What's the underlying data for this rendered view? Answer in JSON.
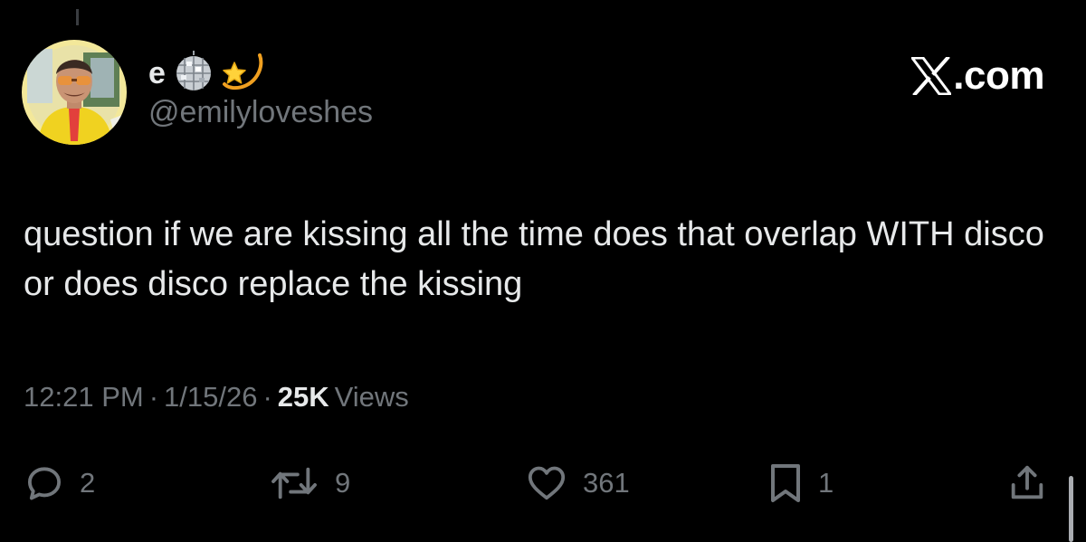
{
  "author": {
    "display_name": "e",
    "handle": "@emilyloveshes",
    "name_emojis": [
      "disco-ball-icon",
      "dizzy-star-icon"
    ]
  },
  "brand": {
    "label": ".com",
    "logo": "x-logo-icon"
  },
  "tweet": {
    "text": "question if we are kissing all the time does that overlap WITH disco or does disco replace the kissing",
    "time": "12:21 PM",
    "date": "1/15/26",
    "separator": "·",
    "views_count": "25K",
    "views_label": "Views"
  },
  "actions": {
    "replies": "2",
    "reposts": "9",
    "likes": "361",
    "bookmarks": "1"
  },
  "colors": {
    "background": "#000000",
    "primary_text": "#e7e9ea",
    "secondary_text": "#71767b",
    "avatar_ring": "#f5e89a"
  }
}
